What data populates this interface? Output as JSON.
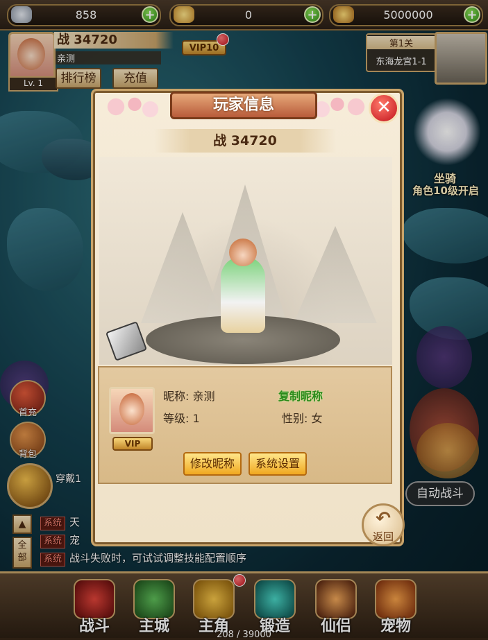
{
  "resources": [
    {
      "icon": "silver-coin-icon",
      "value": "858"
    },
    {
      "icon": "gold-ingot-icon",
      "value": "0"
    },
    {
      "icon": "bound-ingot-icon",
      "value": "5000000"
    }
  ],
  "player": {
    "power": "战 34720",
    "name": "亲测",
    "level": "Lv. 1",
    "vip": "VIP10"
  },
  "header_buttons": {
    "ranking": "排行榜",
    "recharge": "充值"
  },
  "stage": {
    "number": "第1关",
    "name": "东海龙宫1-1"
  },
  "mount": {
    "title": "坐骑",
    "subtitle": "角色10级开启"
  },
  "side": {
    "first_recharge": "首充",
    "bag": "背包",
    "equip": "穿戴1"
  },
  "auto_battle": "自动战斗",
  "chat": {
    "up_label": "▲",
    "all_label": "全部",
    "lines": [
      {
        "tag": "系统",
        "text": "天"
      },
      {
        "tag": "系统",
        "text": "宠"
      },
      {
        "tag": "系统",
        "text": "战斗失败时，可试试调整技能配置顺序"
      }
    ]
  },
  "nav": [
    {
      "label": "战斗",
      "icon": "battle-icon"
    },
    {
      "label": "主城",
      "icon": "main-city-icon"
    },
    {
      "label": "主角",
      "icon": "hero-icon"
    },
    {
      "label": "锻造",
      "icon": "forge-icon"
    },
    {
      "label": "仙侣",
      "icon": "companion-icon"
    },
    {
      "label": "宠物",
      "icon": "pet-icon"
    }
  ],
  "exp": "208 / 39000",
  "modal": {
    "title": "玩家信息",
    "power": "战 34720",
    "nickname_label": "昵称: 亲测",
    "copy_nickname": "复制昵称",
    "level_label": "等级: 1",
    "gender_label": "性别: 女",
    "vip_tag": "VIP",
    "rename_button": "修改昵称",
    "settings_button": "系统设置",
    "back_label": "返回",
    "close_label": "✕"
  },
  "colors": {
    "accent_gold": "#c9a46a",
    "plus_green": "#2f8f18",
    "close_red": "#c1121c",
    "copy_green": "#2b8a1a"
  }
}
